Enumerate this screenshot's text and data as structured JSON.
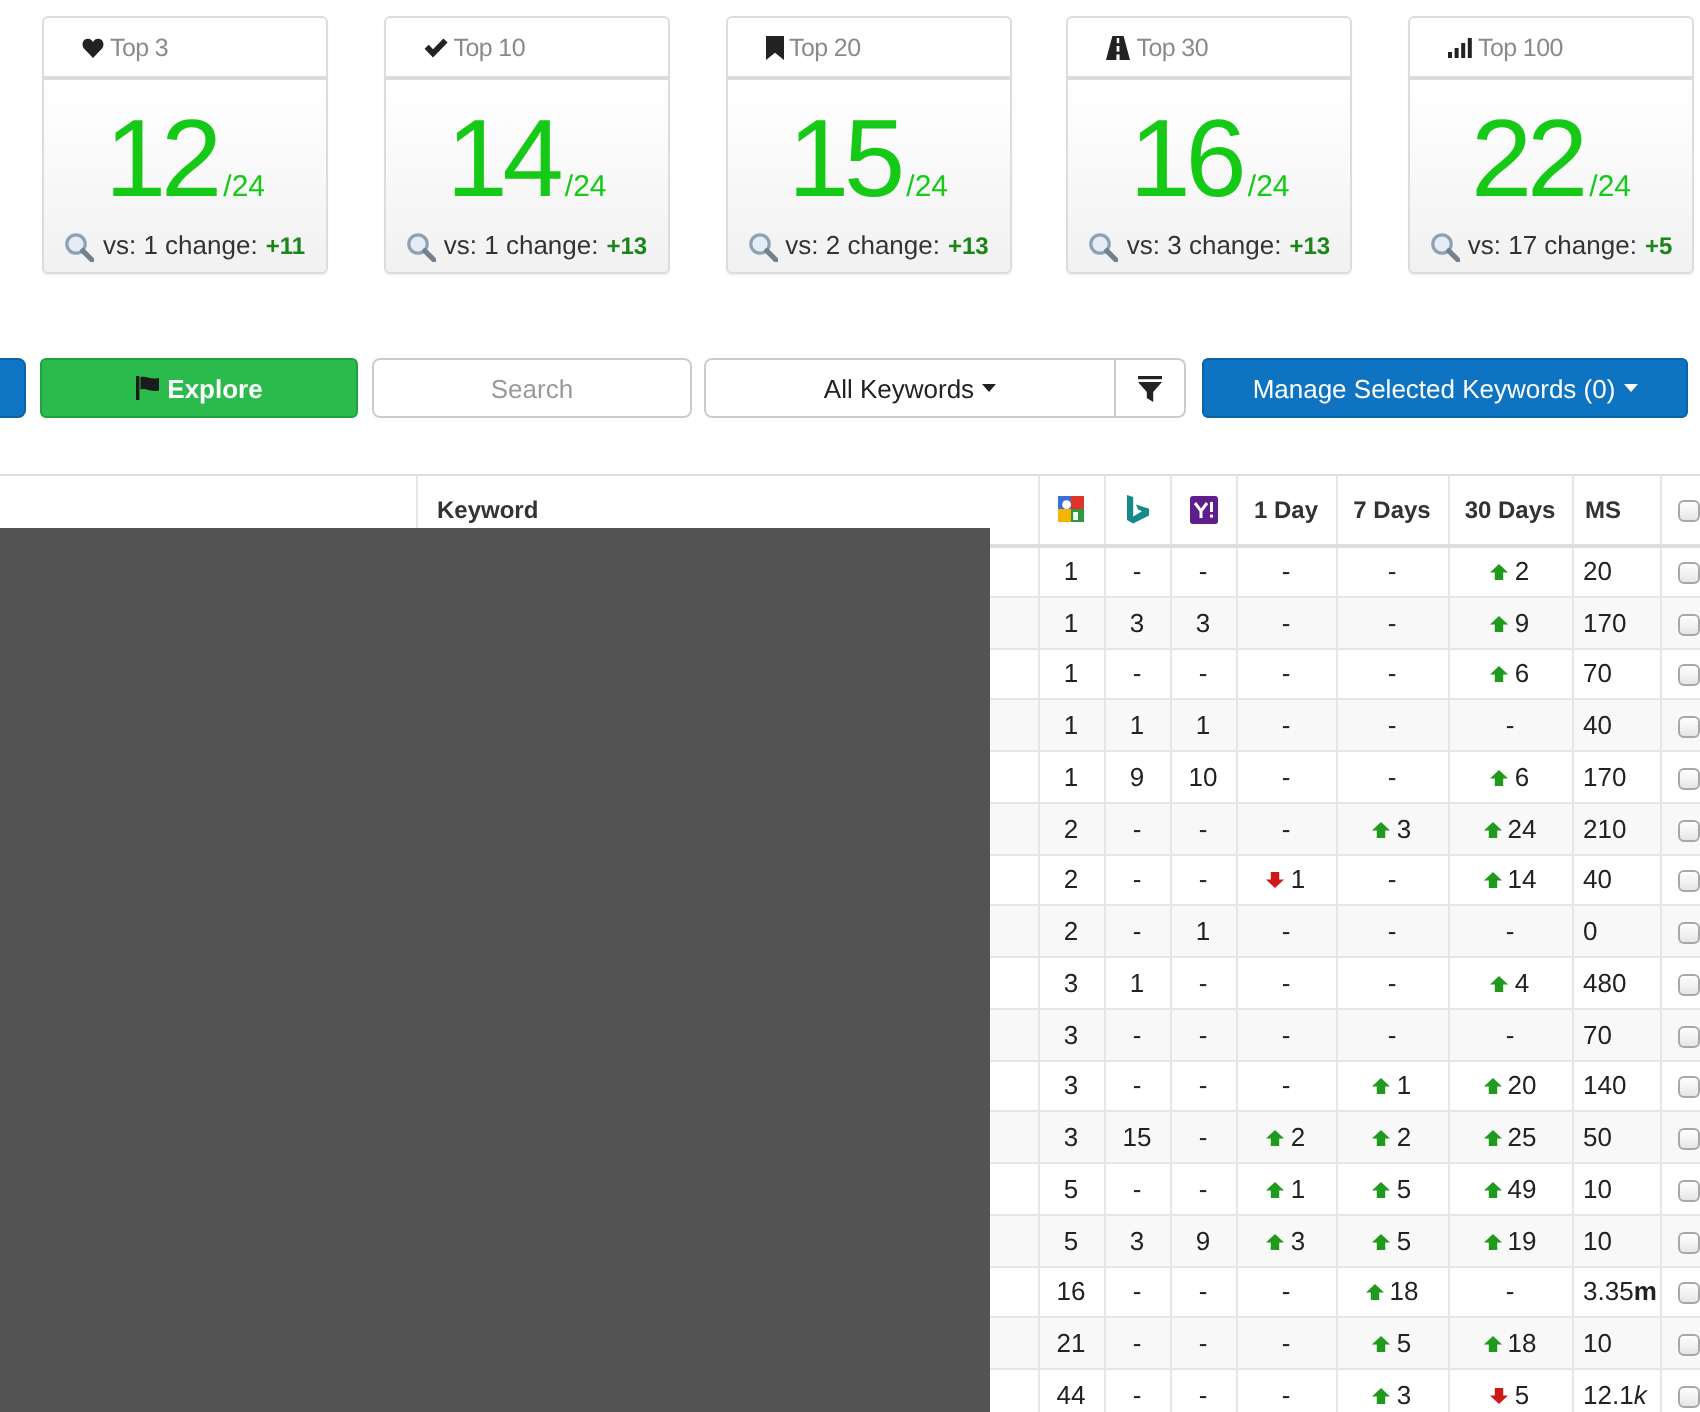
{
  "summary_cards": [
    {
      "label": "Top 3",
      "value": "12",
      "total": "/24",
      "comparison": "vs: 1 change:",
      "change": "+11"
    },
    {
      "label": "Top 10",
      "value": "14",
      "total": "/24",
      "comparison": "vs: 1 change:",
      "change": "+13"
    },
    {
      "label": "Top 20",
      "value": "15",
      "total": "/24",
      "comparison": "vs: 2 change:",
      "change": "+13"
    },
    {
      "label": "Top 30",
      "value": "16",
      "total": "/24",
      "comparison": "vs: 3 change:",
      "change": "+13"
    },
    {
      "label": "Top 100",
      "value": "22",
      "total": "/24",
      "comparison": "vs: 17 change:",
      "change": "+5"
    }
  ],
  "toolbar": {
    "explore_button": "Explore",
    "search": {
      "placeholder": "Search"
    },
    "keyword_filter": "All Keywords",
    "manage_button": "Manage Selected Keywords (0)"
  },
  "table": {
    "keyword_heading": "Keyword",
    "change_headings": [
      "1 Day",
      "7 Days",
      "30 Days"
    ],
    "ms_heading": "MS",
    "select_all": {
      "checked": false
    },
    "rows": [
      {
        "google": "1",
        "bing": "-",
        "yahoo": "-",
        "changes": [
          {
            "kind": "none",
            "value": "-"
          },
          {
            "kind": "none",
            "value": "-"
          },
          {
            "kind": "up",
            "value": "2"
          }
        ],
        "ms": {
          "value": "20"
        },
        "checked": false
      },
      {
        "google": "1",
        "bing": "3",
        "yahoo": "3",
        "changes": [
          {
            "kind": "none",
            "value": "-"
          },
          {
            "kind": "none",
            "value": "-"
          },
          {
            "kind": "up",
            "value": "9"
          }
        ],
        "ms": {
          "value": "170"
        },
        "checked": false
      },
      {
        "google": "1",
        "bing": "-",
        "yahoo": "-",
        "changes": [
          {
            "kind": "none",
            "value": "-"
          },
          {
            "kind": "none",
            "value": "-"
          },
          {
            "kind": "up",
            "value": "6"
          }
        ],
        "ms": {
          "value": "70"
        },
        "checked": false
      },
      {
        "google": "1",
        "bing": "1",
        "yahoo": "1",
        "changes": [
          {
            "kind": "none",
            "value": "-"
          },
          {
            "kind": "none",
            "value": "-"
          },
          {
            "kind": "none",
            "value": "-"
          }
        ],
        "ms": {
          "value": "40"
        },
        "checked": false
      },
      {
        "google": "1",
        "bing": "9",
        "yahoo": "10",
        "changes": [
          {
            "kind": "none",
            "value": "-"
          },
          {
            "kind": "none",
            "value": "-"
          },
          {
            "kind": "up",
            "value": "6"
          }
        ],
        "ms": {
          "value": "170"
        },
        "checked": false
      },
      {
        "google": "2",
        "bing": "-",
        "yahoo": "-",
        "changes": [
          {
            "kind": "none",
            "value": "-"
          },
          {
            "kind": "up",
            "value": "3"
          },
          {
            "kind": "up",
            "value": "24"
          }
        ],
        "ms": {
          "value": "210"
        },
        "checked": false
      },
      {
        "google": "2",
        "bing": "-",
        "yahoo": "-",
        "changes": [
          {
            "kind": "down",
            "value": "1"
          },
          {
            "kind": "none",
            "value": "-"
          },
          {
            "kind": "up",
            "value": "14"
          }
        ],
        "ms": {
          "value": "40"
        },
        "checked": false
      },
      {
        "google": "2",
        "bing": "-",
        "yahoo": "1",
        "changes": [
          {
            "kind": "none",
            "value": "-"
          },
          {
            "kind": "none",
            "value": "-"
          },
          {
            "kind": "none",
            "value": "-"
          }
        ],
        "ms": {
          "value": "0"
        },
        "checked": false
      },
      {
        "google": "3",
        "bing": "1",
        "yahoo": "-",
        "changes": [
          {
            "kind": "none",
            "value": "-"
          },
          {
            "kind": "none",
            "value": "-"
          },
          {
            "kind": "up",
            "value": "4"
          }
        ],
        "ms": {
          "value": "480"
        },
        "checked": false
      },
      {
        "google": "3",
        "bing": "-",
        "yahoo": "-",
        "changes": [
          {
            "kind": "none",
            "value": "-"
          },
          {
            "kind": "none",
            "value": "-"
          },
          {
            "kind": "none",
            "value": "-"
          }
        ],
        "ms": {
          "value": "70"
        },
        "checked": false
      },
      {
        "google": "3",
        "bing": "-",
        "yahoo": "-",
        "changes": [
          {
            "kind": "none",
            "value": "-"
          },
          {
            "kind": "up",
            "value": "1"
          },
          {
            "kind": "up",
            "value": "20"
          }
        ],
        "ms": {
          "value": "140"
        },
        "checked": false
      },
      {
        "google": "3",
        "bing": "15",
        "yahoo": "-",
        "changes": [
          {
            "kind": "up",
            "value": "2"
          },
          {
            "kind": "up",
            "value": "2"
          },
          {
            "kind": "up",
            "value": "25"
          }
        ],
        "ms": {
          "value": "50"
        },
        "checked": false
      },
      {
        "google": "5",
        "bing": "-",
        "yahoo": "-",
        "changes": [
          {
            "kind": "up",
            "value": "1"
          },
          {
            "kind": "up",
            "value": "5"
          },
          {
            "kind": "up",
            "value": "49"
          }
        ],
        "ms": {
          "value": "10"
        },
        "checked": false
      },
      {
        "google": "5",
        "bing": "3",
        "yahoo": "9",
        "changes": [
          {
            "kind": "up",
            "value": "3"
          },
          {
            "kind": "up",
            "value": "5"
          },
          {
            "kind": "up",
            "value": "19"
          }
        ],
        "ms": {
          "value": "10"
        },
        "checked": false
      },
      {
        "google": "16",
        "bing": "-",
        "yahoo": "-",
        "changes": [
          {
            "kind": "none",
            "value": "-"
          },
          {
            "kind": "up",
            "value": "18"
          },
          {
            "kind": "none",
            "value": "-"
          }
        ],
        "ms": {
          "value": "3.35",
          "suffix": {
            "kind": "bold",
            "text": "m"
          }
        },
        "checked": false
      },
      {
        "google": "21",
        "bing": "-",
        "yahoo": "-",
        "changes": [
          {
            "kind": "none",
            "value": "-"
          },
          {
            "kind": "up",
            "value": "5"
          },
          {
            "kind": "up",
            "value": "18"
          }
        ],
        "ms": {
          "value": "10"
        },
        "checked": false
      },
      {
        "google": "44",
        "bing": "-",
        "yahoo": "-",
        "changes": [
          {
            "kind": "none",
            "value": "-"
          },
          {
            "kind": "up",
            "value": "3"
          },
          {
            "kind": "down",
            "value": "5"
          }
        ],
        "ms": {
          "value": "12.1",
          "suffix": {
            "kind": "italic",
            "text": "k"
          }
        },
        "checked": false
      }
    ]
  }
}
